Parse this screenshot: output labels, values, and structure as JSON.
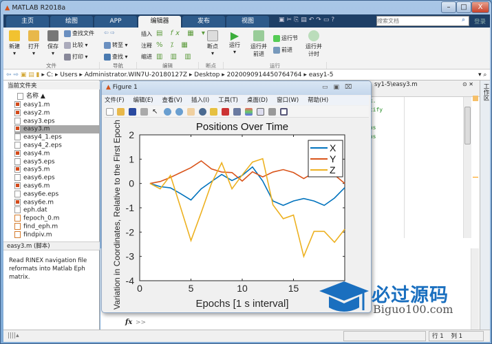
{
  "app": {
    "title": "MATLAB R2018a"
  },
  "window_controls": {
    "minimize": "–",
    "maximize": "□",
    "close": "X"
  },
  "tabs": [
    "主页",
    "绘图",
    "APP",
    "编辑器",
    "发布",
    "视图"
  ],
  "search": {
    "placeholder": "搜索文档",
    "login": "登录"
  },
  "ribbon": {
    "new": "新建",
    "open": "打开",
    "save": "保存",
    "find_files": "查找文件",
    "compare": "比较",
    "print": "打印",
    "goto": "转至",
    "find": "查找",
    "insert": "插入",
    "comment": "注释",
    "indent": "缩进",
    "fx": "fx",
    "breakpoint": "断点",
    "run": "运行",
    "run_advance": [
      "运行并",
      "前进"
    ],
    "run_section": "运行节",
    "advance": "前进",
    "run_time": [
      "运行并",
      "计时"
    ],
    "groups": [
      "文件",
      "导航",
      "编辑",
      "断点",
      "运行"
    ]
  },
  "address": {
    "path": [
      "C:",
      "Users",
      "Administrator.WIN7U-20180127Z",
      "Desktop",
      "2020090914450764764",
      "easy1-5"
    ]
  },
  "current_folder": {
    "title": "当前文件夹",
    "column": "名称 ▲",
    "files": [
      {
        "name": "easy1.m",
        "type": "m"
      },
      {
        "name": "easy2.m",
        "type": "m"
      },
      {
        "name": "easy3.eps",
        "type": "eps"
      },
      {
        "name": "easy3.m",
        "type": "m",
        "selected": true
      },
      {
        "name": "easy4_1.eps",
        "type": "eps"
      },
      {
        "name": "easy4_2.eps",
        "type": "eps"
      },
      {
        "name": "easy4.m",
        "type": "m"
      },
      {
        "name": "easy5.eps",
        "type": "eps"
      },
      {
        "name": "easy5.m",
        "type": "m"
      },
      {
        "name": "easy6.eps",
        "type": "eps"
      },
      {
        "name": "easy6.m",
        "type": "m"
      },
      {
        "name": "easy6e.eps",
        "type": "eps"
      },
      {
        "name": "easy6e.m",
        "type": "m"
      },
      {
        "name": "eph.dat",
        "type": "dat"
      },
      {
        "name": "fepoch_0.m",
        "type": "f"
      },
      {
        "name": "find_eph.m",
        "type": "f"
      },
      {
        "name": "findpiv.m",
        "type": "f"
      }
    ]
  },
  "details": {
    "title": "easy3.m  (脚本)",
    "text": "Read RINEX navigation file reformats into Matlab Eph matrix."
  },
  "editor": {
    "tab": "sy1-5\\easy3.m",
    "lines": [
      "ix.",
      "ntify",
      "e",
      "ons",
      "ons"
    ],
    "side_label": "工作区"
  },
  "command": {
    "prompt": ">>",
    "fx": "fx"
  },
  "status": {
    "row_label": "行",
    "row": "1",
    "col_label": "列",
    "col": "1"
  },
  "figure": {
    "title": "Figure 1",
    "menu": [
      "文件(F)",
      "编辑(E)",
      "查看(V)",
      "插入(I)",
      "工具(T)",
      "桌面(D)",
      "窗口(W)",
      "帮助(H)"
    ]
  },
  "watermark": {
    "cn": "必过源码",
    "en": "Biguo100.com"
  },
  "chart_data": {
    "type": "line",
    "title": "Positions Over Time",
    "xlabel": "Epochs [1 s interval]",
    "ylabel": "Variation in Coordinates, Relative to the First Epoch",
    "ylabel_visible": "ion in Coordinates, Relative to the First E",
    "xlim": [
      0,
      20
    ],
    "ylim": [
      -4,
      2
    ],
    "xticks": [
      0,
      5,
      10,
      15
    ],
    "yticks": [
      2,
      1,
      0,
      -1,
      -2,
      -3,
      -4
    ],
    "legend_position": "top-right",
    "x": [
      1,
      2,
      3,
      4,
      5,
      6,
      7,
      8,
      9,
      10,
      11,
      12,
      13,
      14,
      15,
      16,
      17,
      18,
      19,
      20
    ],
    "series": [
      {
        "name": "X",
        "color": "#0072BD",
        "values": [
          0,
          -0.13,
          -0.18,
          -0.42,
          -0.68,
          -0.22,
          0.08,
          0.37,
          0.12,
          0.33,
          0.68,
          0.1,
          -0.72,
          -0.9,
          -0.72,
          -0.62,
          -0.72,
          -0.9,
          -0.6,
          -0.17
        ]
      },
      {
        "name": "Y",
        "color": "#D95319",
        "values": [
          0,
          0.08,
          0.25,
          0.45,
          0.65,
          0.93,
          0.6,
          0.47,
          0.45,
          0.1,
          0.48,
          0.27,
          0.47,
          0.57,
          0.45,
          0.2,
          0.45,
          0.5,
          0.35,
          0
        ]
      },
      {
        "name": "Z",
        "color": "#EDB120",
        "values": [
          0,
          -0.22,
          0.33,
          -1.0,
          -2.35,
          -1.2,
          0.0,
          0.85,
          -0.22,
          0.35,
          0.88,
          1.02,
          -0.88,
          -1.45,
          -1.3,
          -3.0,
          -1.97,
          -1.97,
          -2.42,
          -1.88
        ]
      }
    ]
  }
}
